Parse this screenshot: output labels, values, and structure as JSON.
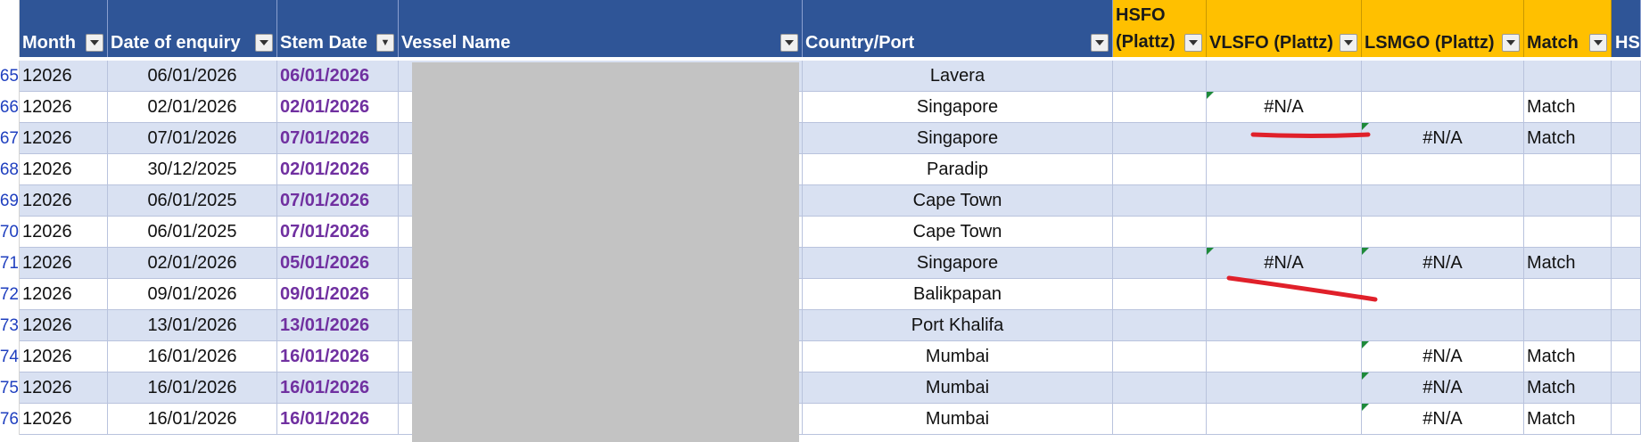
{
  "columns": {
    "month": "Month",
    "date_of_enquiry": "Date of enquiry",
    "stem_date": "Stem Date",
    "vessel_name": "Vessel Name",
    "country_port": "Country/Port",
    "hsfo_line1": "HSFO",
    "hsfo_line2": "(Plattz)",
    "vlsfo": "VLSFO (Plattz)",
    "lsmgo": "LSMGO (Plattz)",
    "match": "Match",
    "hs_partial": "HSI"
  },
  "rows": [
    {
      "num": "65",
      "month": "12026",
      "enquiry": "06/01/2026",
      "stem": "06/01/2026",
      "port": "Lavera",
      "vlsfo": "",
      "lsmgo": "",
      "match": ""
    },
    {
      "num": "66",
      "month": "12026",
      "enquiry": "02/01/2026",
      "stem": "02/01/2026",
      "port": "Singapore",
      "vlsfo": "#N/A",
      "lsmgo": "",
      "match": "Match"
    },
    {
      "num": "67",
      "month": "12026",
      "enquiry": "07/01/2026",
      "stem": "07/01/2026",
      "port": "Singapore",
      "vlsfo": "",
      "lsmgo": "#N/A",
      "match": "Match"
    },
    {
      "num": "68",
      "month": "12026",
      "enquiry": "30/12/2025",
      "stem": "02/01/2026",
      "port": "Paradip",
      "vlsfo": "",
      "lsmgo": "",
      "match": ""
    },
    {
      "num": "69",
      "month": "12026",
      "enquiry": "06/01/2025",
      "stem": "07/01/2026",
      "port": "Cape Town",
      "vlsfo": "",
      "lsmgo": "",
      "match": ""
    },
    {
      "num": "70",
      "month": "12026",
      "enquiry": "06/01/2025",
      "stem": "07/01/2026",
      "port": "Cape Town",
      "vlsfo": "",
      "lsmgo": "",
      "match": ""
    },
    {
      "num": "71",
      "month": "12026",
      "enquiry": "02/01/2026",
      "stem": "05/01/2026",
      "port": "Singapore",
      "vlsfo": "#N/A",
      "lsmgo": "#N/A",
      "match": "Match"
    },
    {
      "num": "72",
      "month": "12026",
      "enquiry": "09/01/2026",
      "stem": "09/01/2026",
      "port": "Balikpapan",
      "vlsfo": "",
      "lsmgo": "",
      "match": ""
    },
    {
      "num": "73",
      "month": "12026",
      "enquiry": "13/01/2026",
      "stem": "13/01/2026",
      "port": "Port Khalifa",
      "vlsfo": "",
      "lsmgo": "",
      "match": ""
    },
    {
      "num": "74",
      "month": "12026",
      "enquiry": "16/01/2026",
      "stem": "16/01/2026",
      "port": "Mumbai",
      "vlsfo": "",
      "lsmgo": "#N/A",
      "match": "Match"
    },
    {
      "num": "75",
      "month": "12026",
      "enquiry": "16/01/2026",
      "stem": "16/01/2026",
      "port": "Mumbai",
      "vlsfo": "",
      "lsmgo": "#N/A",
      "match": "Match"
    },
    {
      "num": "76",
      "month": "12026",
      "enquiry": "16/01/2026",
      "stem": "16/01/2026",
      "port": "Mumbai",
      "vlsfo": "",
      "lsmgo": "#N/A",
      "match": "Match"
    }
  ],
  "colors": {
    "header_blue": "#2f5597",
    "header_gold": "#ffc000",
    "band_row": "#d9e1f2",
    "stem_text": "#7030a0",
    "annotation_red": "#e0202a",
    "error_flag": "#1e8a3a"
  },
  "icons": {
    "filter_dropdown": "chevron-down-icon",
    "filter_active": "funnel-filter-icon"
  }
}
